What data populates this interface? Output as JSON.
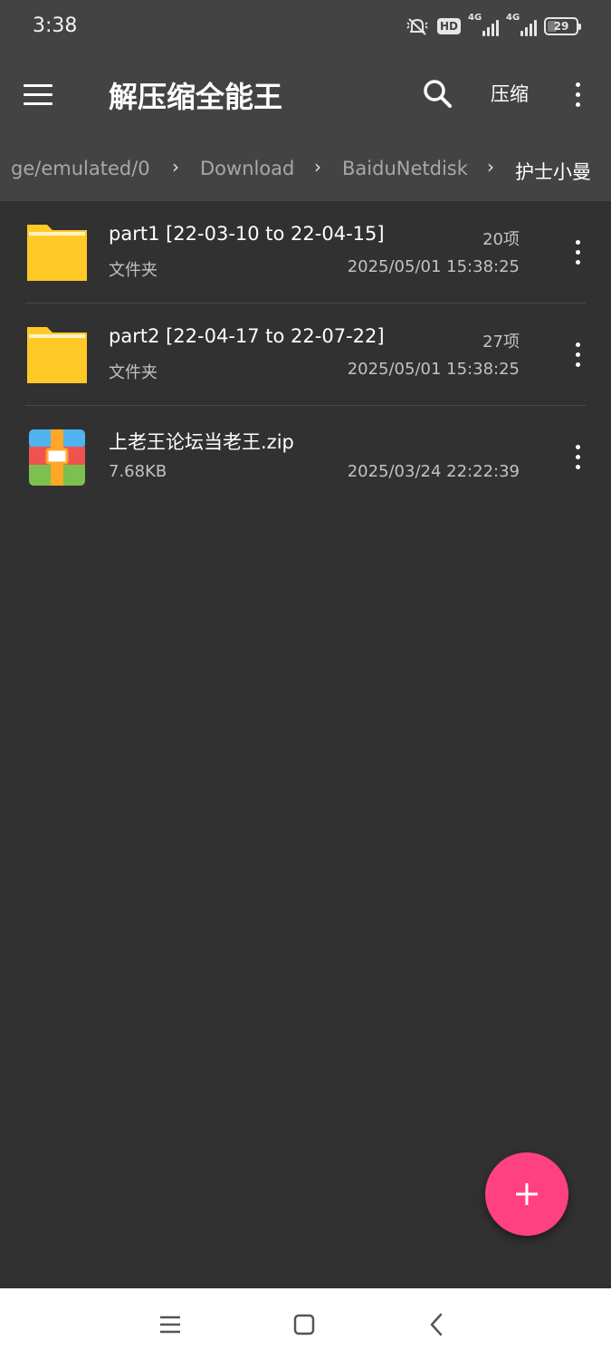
{
  "status_bar": {
    "time": "3:38",
    "hd_badge": "HD",
    "network_1": "4G",
    "network_2": "4G",
    "battery_level": "29",
    "icons": [
      "mute-icon",
      "hd-icon",
      "signal-icon",
      "signal-icon",
      "battery-icon"
    ]
  },
  "app_bar": {
    "menu_icon": "hamburger-menu-icon",
    "title": "解压缩全能王",
    "search_icon": "search-icon",
    "compress_label": "压缩",
    "overflow_icon": "more-vert-icon"
  },
  "breadcrumbs": [
    {
      "label": "ge/emulated/0"
    },
    {
      "label": "Download"
    },
    {
      "label": "BaiduNetdisk"
    },
    {
      "label": "护士小曼"
    }
  ],
  "files": [
    {
      "name": "part1 [22-03-10 to 22-04-15]",
      "type_label": "文件夹",
      "count": "20项",
      "modified": "2025/05/01 15:38:25",
      "icon": "folder-icon"
    },
    {
      "name": "part2 [22-04-17 to 22-07-22]",
      "type_label": "文件夹",
      "count": "27项",
      "modified": "2025/05/01 15:38:25",
      "icon": "folder-icon"
    },
    {
      "name": "上老王论坛当老王.zip",
      "size": "7.68KB",
      "modified": "2025/03/24 22:22:39",
      "icon": "zip-archive-icon"
    }
  ],
  "fab": {
    "icon": "plus-icon"
  },
  "nav_bar": {
    "icons": [
      "recents-icon",
      "home-icon",
      "back-icon"
    ]
  },
  "colors": {
    "background": "#313131",
    "toolbar": "#434343",
    "accent": "#ff4081",
    "folder": "#ffc928",
    "text_secondary": "#c2c2c2"
  }
}
